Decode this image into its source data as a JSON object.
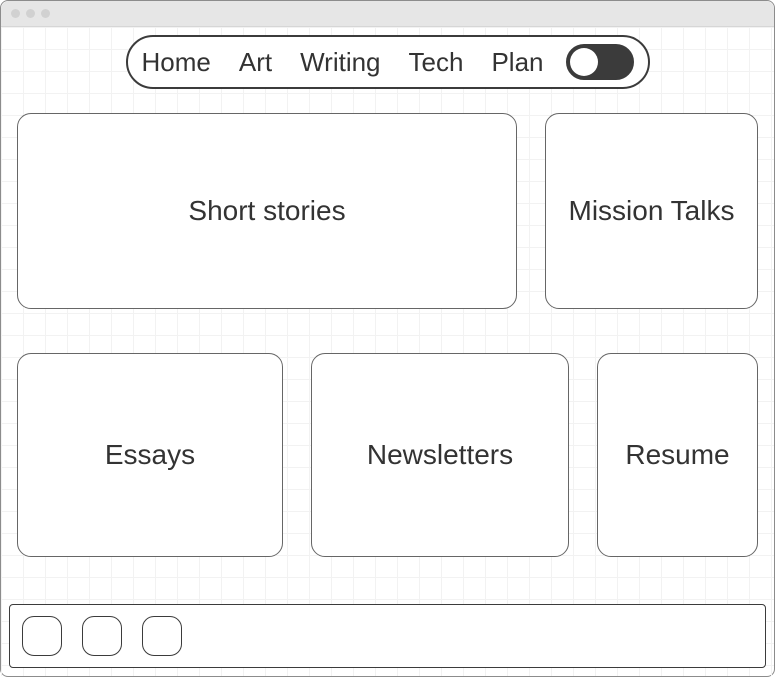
{
  "nav": {
    "items": [
      {
        "label": "Home"
      },
      {
        "label": "Art"
      },
      {
        "label": "Writing"
      },
      {
        "label": "Tech"
      },
      {
        "label": "Plan"
      }
    ],
    "toggle_on": false
  },
  "cards": {
    "short_stories": "Short stories",
    "mission_talks": "Mission Talks",
    "essays": "Essays",
    "newsletters": "Newsletters",
    "resume": "Resume"
  }
}
